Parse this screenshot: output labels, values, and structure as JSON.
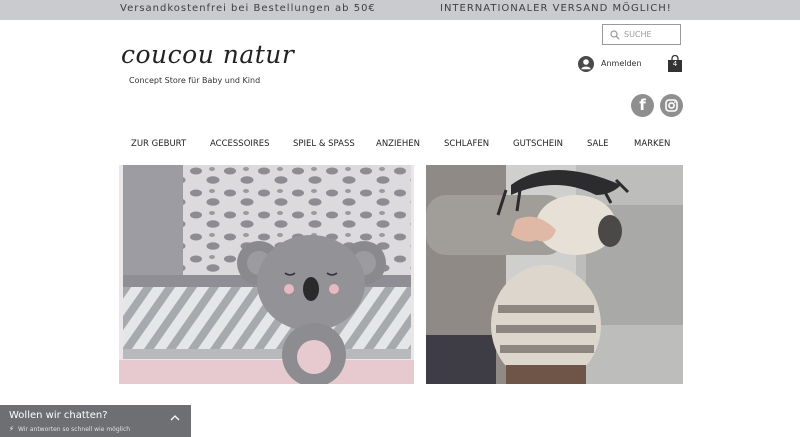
{
  "topbar": {
    "left_text": "Versandkostenfrei bei Bestellungen ab 50€",
    "right_text": "INTERNATIONALER VERSAND MÖGLICH!"
  },
  "header": {
    "logo": "coucou natur",
    "tagline": "Concept Store für Baby und Kind",
    "search_placeholder": "SUCHE",
    "login_label": "Anmelden",
    "cart_count": "4"
  },
  "social": {
    "facebook_icon": "f",
    "instagram_icon": "instagram-icon"
  },
  "nav": {
    "items": [
      "ZUR GEBURT",
      "ACCESSOIRES",
      "SPIEL & SPASS",
      "ANZIEHEN",
      "SCHLAFEN",
      "GUTSCHEIN",
      "SALE",
      "MARKEN"
    ]
  },
  "hero": {
    "left_image": "koala rattle on knitted blankets",
    "right_image": "child holding zebra plush toy"
  },
  "chat": {
    "title": "Wollen wir chatten?",
    "subtitle": "Wir antworten so schnell wie möglich"
  },
  "colors": {
    "topbar_bg": "#c9cbce",
    "chat_bg": "#6e6f72",
    "social_bg": "#8f8f8f"
  }
}
